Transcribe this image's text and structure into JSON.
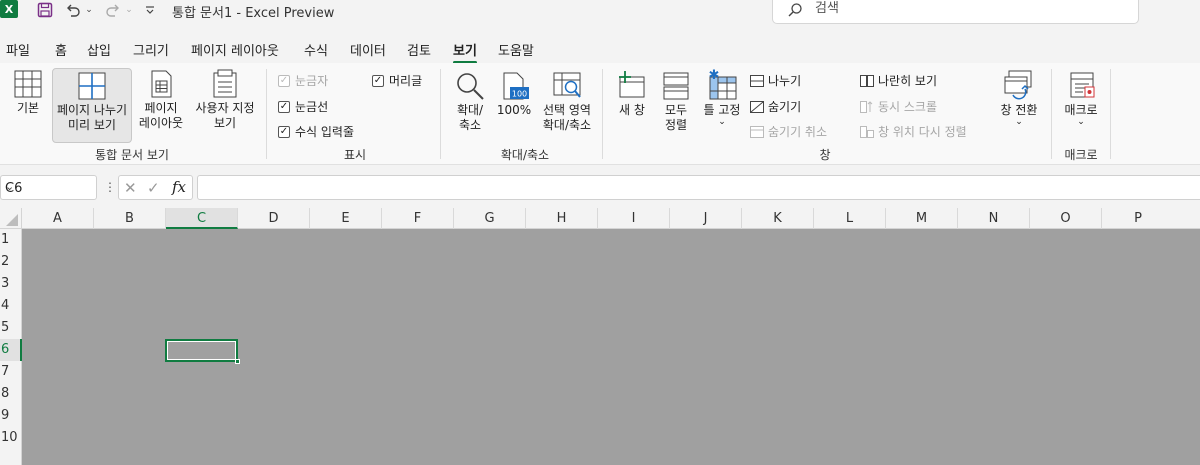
{
  "app": {
    "title": "통합 문서1  -  Excel Preview",
    "logo_letter": "X",
    "accent_color": "#107c41"
  },
  "search": {
    "placeholder": "검색"
  },
  "menu_tabs": [
    "파일",
    "홈",
    "삽입",
    "그리기",
    "페이지 레이아웃",
    "수식",
    "데이터",
    "검토",
    "보기",
    "도움말"
  ],
  "active_tab": "보기",
  "ribbon": {
    "workbook_views": {
      "label": "통합 문서 보기",
      "normal": "기본",
      "page_break_1": "페이지 나누기",
      "page_break_2": "미리 보기",
      "page_layout_1": "페이지",
      "page_layout_2": "레이아웃",
      "custom_1": "사용자 지정",
      "custom_2": "보기"
    },
    "show": {
      "label": "표시",
      "ruler": "눈금자",
      "headings": "머리글",
      "gridlines": "눈금선",
      "formula_bar": "수식 입력줄"
    },
    "zoom": {
      "label": "확대/축소",
      "zoom_1": "확대/",
      "zoom_2": "축소",
      "hundred": "100%",
      "hundred_icon": "100",
      "to_selection_1": "선택 영역",
      "to_selection_2": "확대/축소"
    },
    "window": {
      "label": "창",
      "new_window": "새 창",
      "arrange_1": "모두",
      "arrange_2": "정렬",
      "freeze": "틀 고정",
      "split": "나누기",
      "hide": "숨기기",
      "unhide": "숨기기 취소",
      "side_by_side": "나란히 보기",
      "sync_scroll": "동시 스크롤",
      "reset_position": "창 위치 다시 정렬",
      "switch": "창 전환"
    },
    "macros": {
      "label": "매크로",
      "macros": "매크로"
    }
  },
  "formula_bar": {
    "name_box": "C6",
    "fx": "fx",
    "content": ""
  },
  "columns": [
    "A",
    "B",
    "C",
    "D",
    "E",
    "F",
    "G",
    "H",
    "I",
    "J",
    "K",
    "L",
    "M",
    "N",
    "O",
    "P"
  ],
  "rows": [
    "1",
    "2",
    "3",
    "4",
    "5",
    "6",
    "7",
    "8",
    "9",
    "10"
  ],
  "selected_cell": {
    "column": "C",
    "row": "6"
  }
}
